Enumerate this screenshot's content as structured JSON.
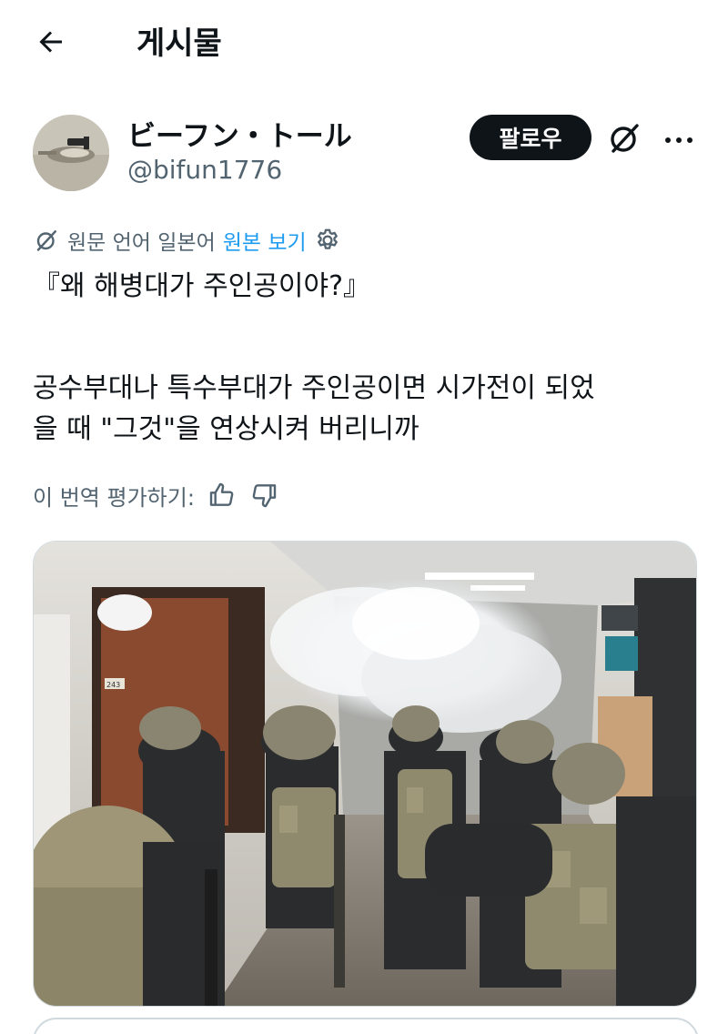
{
  "header": {
    "title": "게시물"
  },
  "author": {
    "display_name": "ビーフン・トール",
    "handle": "@bifun1776",
    "follow_label": "팔로우"
  },
  "translation": {
    "note": "원문 언어 일본어",
    "view_original": "원본 보기"
  },
  "post": {
    "line1": "『왜 해병대가 주인공이야?』",
    "line2": "공수부대나 특수부대가 주인공이면 시가전이 되었",
    "line3": "을 때 \"그것\"을 연상시켜 버리니까"
  },
  "rate": {
    "label": "이 번역 평가하기:"
  },
  "media": {
    "room_number": "243"
  },
  "colors": {
    "text": "#0f1419",
    "secondary": "#536471",
    "link": "#1d9bf0",
    "follow_bg": "#0f1419"
  }
}
